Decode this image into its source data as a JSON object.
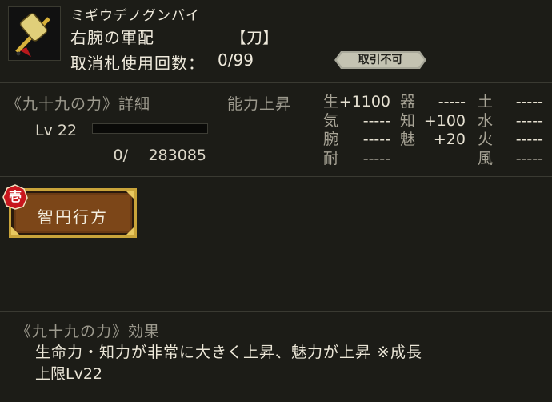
{
  "item": {
    "kana": "ミギウデノグンバイ",
    "name": "右腕の軍配",
    "category": "【刀】",
    "uses_label": "取消札使用回数：",
    "uses_value": "0/99",
    "badge": "取引不可",
    "icon": "gunbai-fan-icon"
  },
  "detail": {
    "title": "《九十九の力》詳細",
    "level": "Lv 22",
    "exp_current": "0/",
    "exp_max": "283085",
    "exp_progress": 0.0
  },
  "stats": {
    "title": "能力上昇",
    "col1": [
      {
        "key": "生",
        "value": "+1100"
      },
      {
        "key": "気",
        "value": "-----"
      },
      {
        "key": "腕",
        "value": "-----"
      },
      {
        "key": "耐",
        "value": "-----"
      }
    ],
    "col2": [
      {
        "key": "器",
        "value": "-----"
      },
      {
        "key": "知",
        "value": "+100"
      },
      {
        "key": "魅",
        "value": "+20"
      }
    ],
    "col3": [
      {
        "key": "土",
        "value": "-----"
      },
      {
        "key": "水",
        "value": "-----"
      },
      {
        "key": "火",
        "value": "-----"
      },
      {
        "key": "風",
        "value": "-----"
      }
    ]
  },
  "skill": {
    "seal": "壱",
    "name": "智円行方"
  },
  "effect": {
    "title": "《九十九の力》効果",
    "line1": "生命力・知力が非常に大きく上昇、魅力が上昇 ※成長",
    "line2": "上限Lv22"
  },
  "colors": {
    "background": "#1c1c17",
    "skill_gold": "#c9a43a",
    "skill_brown": "#6a3a14",
    "seal_red": "#c8161d"
  }
}
